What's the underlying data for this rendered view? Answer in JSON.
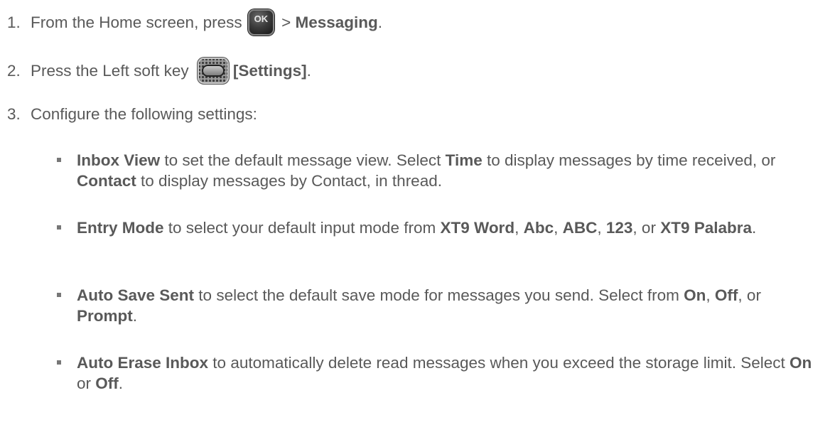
{
  "steps": [
    {
      "num": "1.",
      "text_before": "From the Home screen, press ",
      "key_label": "OK",
      "text_mid": " > ",
      "bold": "Messaging",
      "text_after": "."
    },
    {
      "num": "2.",
      "text_before": "Press the Left soft key ",
      "bold": "[Settings]",
      "text_after": "."
    },
    {
      "num": "3.",
      "text": "Configure the following settings:"
    }
  ],
  "settings": [
    {
      "parts": [
        "Inbox View",
        " to set the default message view. Select ",
        "Time",
        " to display messages by time received, or ",
        "Contact",
        " to display messages by Contact, in thread."
      ]
    },
    {
      "parts": [
        "Entry Mode",
        " to select your default input mode from ",
        "XT9 Word",
        ", ",
        "Abc",
        ", ",
        "ABC",
        ", ",
        "123",
        ", or ",
        "XT9 Palabra",
        "."
      ]
    },
    {
      "parts": [
        "Auto Save Sent",
        " to select the default save mode for messages you send. Select from ",
        "On",
        ", ",
        "Off",
        ", or ",
        "Prompt",
        "."
      ]
    },
    {
      "parts": [
        "Auto Erase Inbox",
        " to automatically delete read messages when you exceed the storage limit. Select ",
        "On",
        " or ",
        "Off",
        "."
      ]
    }
  ],
  "icons": {
    "ok_key": "ok-key-icon",
    "left_soft_key": "left-soft-key-icon"
  }
}
